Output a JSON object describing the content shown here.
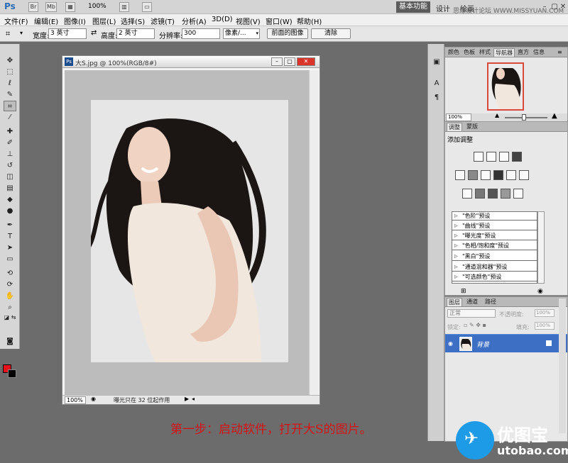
{
  "app": {
    "logo": "Ps",
    "workspace": "基本功能",
    "workspace_design": "设计",
    "workspace_paint": "绘画",
    "watermark": "思缘设计论坛 WWW.MISSYUAN.COM",
    "zoom": "100%"
  },
  "menu": [
    "文件(F)",
    "编辑(E)",
    "图像(I)",
    "图层(L)",
    "选择(S)",
    "滤镜(T)",
    "分析(A)",
    "3D(D)",
    "视图(V)",
    "窗口(W)",
    "帮助(H)"
  ],
  "options": {
    "width_label": "宽度:",
    "width_value": "3 英寸",
    "height_label": "高度:",
    "height_value": "2 英寸",
    "res_label": "分辨率:",
    "res_value": "300",
    "unit_value": "像素/...",
    "front_image_btn": "前面的图像",
    "clear_btn": "清除"
  },
  "document": {
    "title": "大S.jpg @ 100%(RGB/8#)",
    "zoom": "100%",
    "status": "曝光只在 32 位起作用"
  },
  "navigator": {
    "tabs": [
      "颜色",
      "色板",
      "样式",
      "导航器",
      "直方",
      "信息"
    ],
    "active": 3,
    "zoom": "100%"
  },
  "adjustments": {
    "tabs": [
      "调整",
      "蒙版"
    ],
    "title": "添加调整",
    "presets": [
      "\"色阶\"预设",
      "\"曲线\"预设",
      "\"曝光度\"预设",
      "\"色相/饱和度\"预设",
      "\"黑白\"预设",
      "\"通道混和器\"预设",
      "\"可选颜色\"预设"
    ]
  },
  "layers": {
    "tabs": [
      "图层",
      "通道",
      "路径"
    ],
    "blend": "正常",
    "opacity_label": "不透明度:",
    "opacity": "100%",
    "lock_label": "锁定:",
    "fill_label": "填充:",
    "fill": "100%",
    "layer_name": "背景"
  },
  "caption": "第一步：启动软件，打开大S的图片。",
  "logo": {
    "cn": "优图宝",
    "en": "utobao.com"
  },
  "colors": {
    "foreground": "#e8121c",
    "background": "#000000",
    "accent": "#3d6fc4"
  }
}
